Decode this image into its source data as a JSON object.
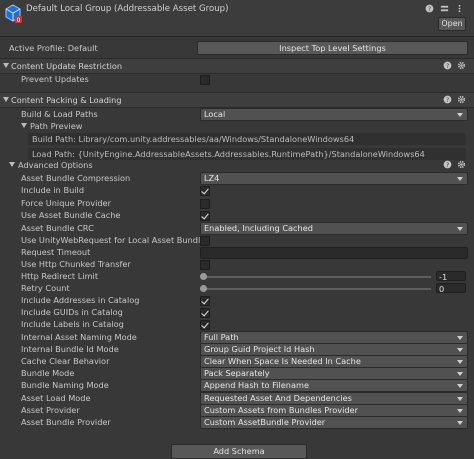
{
  "header": {
    "title": "Default Local Group (Addressable Asset Group)",
    "open_label": "Open"
  },
  "profile": {
    "label": "Active Profile: Default",
    "inspect_label": "Inspect Top Level Settings"
  },
  "content_update": {
    "title": "Content Update Restriction",
    "prevent_updates_label": "Prevent Updates",
    "prevent_updates_checked": false
  },
  "packing": {
    "title": "Content Packing & Loading",
    "build_load_label": "Build & Load Paths",
    "build_load_value": "Local",
    "path_preview_label": "Path Preview",
    "build_path": "Build Path: Library/com.unity.addressables/aa/Windows/StandaloneWindows64",
    "load_path": "Load Path: {UnityEngine.AddressableAssets.Addressables.RuntimePath}/StandaloneWindows64",
    "advanced_label": "Advanced Options"
  },
  "advanced": {
    "compression_label": "Asset Bundle Compression",
    "compression_value": "LZ4",
    "include_in_build_label": "Include in Build",
    "force_unique_label": "Force Unique Provider",
    "use_cache_label": "Use Asset Bundle Cache",
    "crc_label": "Asset Bundle CRC",
    "crc_value": "Enabled, Including Cached",
    "uwr_label": "Use UnityWebRequest for Local Asset Bundles",
    "timeout_label": "Request Timeout",
    "chunked_label": "Use Http Chunked Transfer",
    "redirect_label": "Http Redirect Limit",
    "redirect_value": "-1",
    "retry_label": "Retry Count",
    "retry_value": "0",
    "incl_addresses_label": "Include Addresses in Catalog",
    "incl_guids_label": "Include GUIDs in Catalog",
    "incl_labels_label": "Include Labels in Catalog",
    "naming_mode_label": "Internal Asset Naming Mode",
    "naming_mode_value": "Full Path",
    "bundle_id_label": "Internal Bundle Id Mode",
    "bundle_id_value": "Group Guid Project Id Hash",
    "cache_clear_label": "Cache Clear Behavior",
    "cache_clear_value": "Clear When Space Is Needed In Cache",
    "bundle_mode_label": "Bundle Mode",
    "bundle_mode_value": "Pack Separately",
    "bundle_naming_label": "Bundle Naming Mode",
    "bundle_naming_value": "Append Hash to Filename",
    "load_mode_label": "Asset Load Mode",
    "load_mode_value": "Requested Asset And Dependencies",
    "asset_provider_label": "Asset Provider",
    "asset_provider_value": "Custom Assets from Bundles Provider",
    "bundle_provider_label": "Asset Bundle Provider",
    "bundle_provider_value": "Custom AssetBundle Provider"
  },
  "footer": {
    "add_schema_label": "Add Schema"
  },
  "checks": {
    "include_in_build": true,
    "force_unique": false,
    "use_cache": true,
    "uwr": false,
    "chunked": false,
    "incl_addresses": true,
    "incl_guids": true,
    "incl_labels": true
  }
}
